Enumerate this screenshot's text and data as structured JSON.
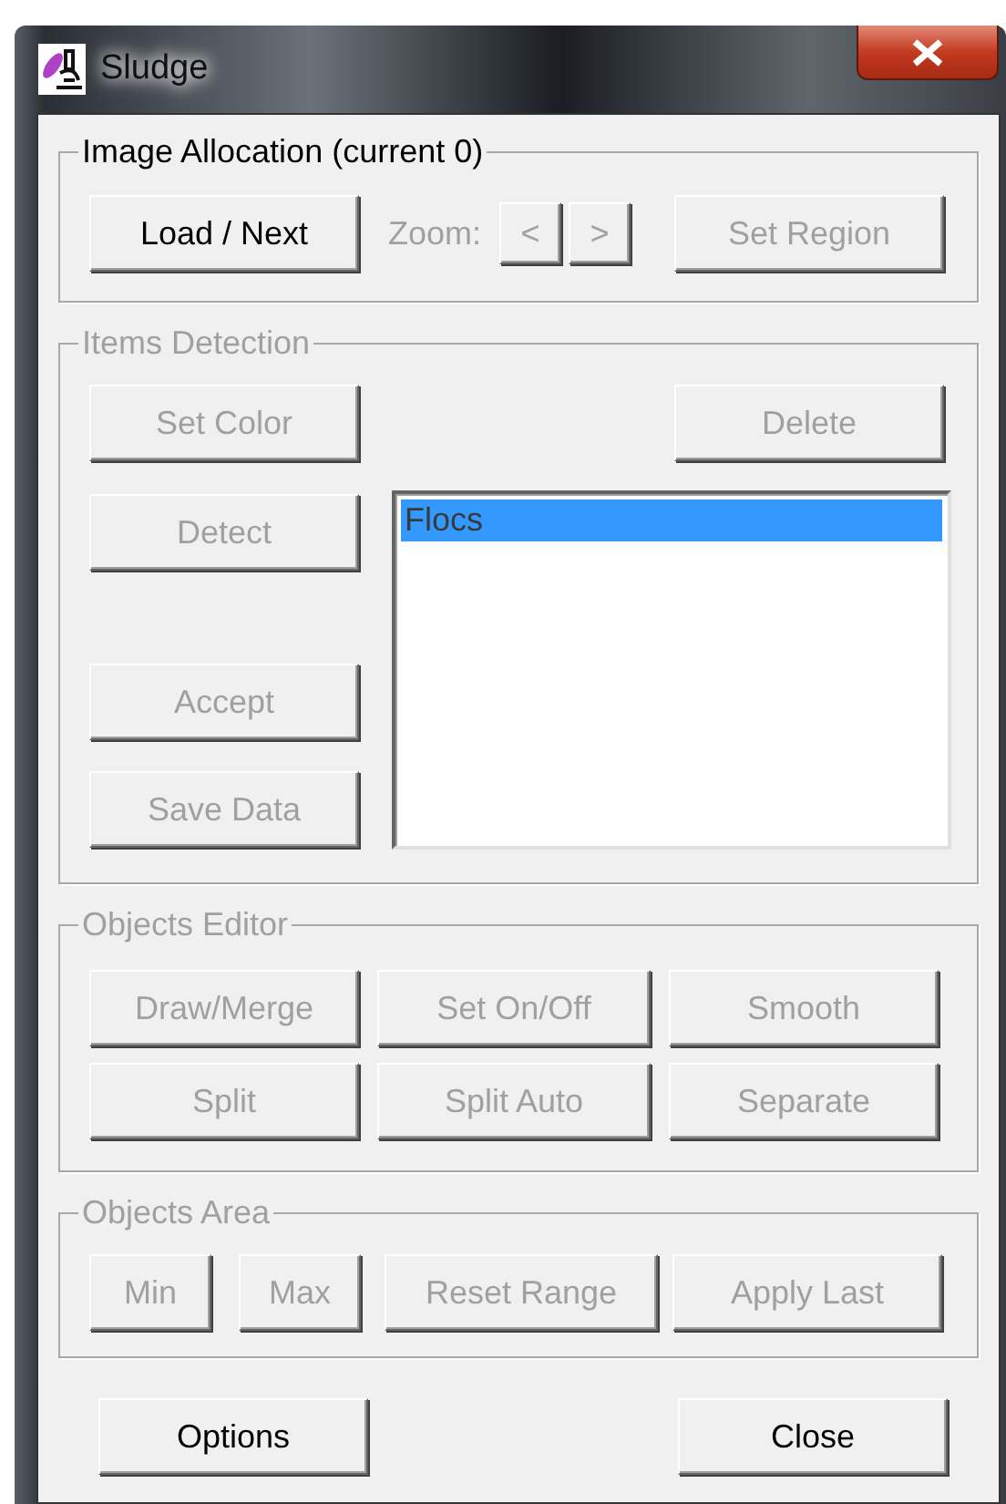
{
  "window": {
    "title": "Sludge"
  },
  "image_allocation": {
    "title": "Image Allocation (current 0)",
    "disabled": false,
    "load_button": {
      "label": "Load / Next",
      "disabled": false
    },
    "zoom_label": {
      "text": "Zoom:",
      "disabled": true
    },
    "zoom_buttons": [
      {
        "label": "<",
        "disabled": true
      },
      {
        "label": ">",
        "disabled": true
      }
    ],
    "set_region_button": {
      "label": "Set Region",
      "disabled": true
    }
  },
  "items_detection": {
    "title": "Items Detection",
    "disabled": true,
    "left_buttons": [
      {
        "label": "Set Color",
        "disabled": true
      },
      {
        "label": "Detect",
        "disabled": true
      },
      {
        "label": "Accept",
        "disabled": true
      },
      {
        "label": "Save Data",
        "disabled": true
      }
    ],
    "delete_button": {
      "label": "Delete",
      "disabled": true
    },
    "list_items": [
      {
        "text": "Flocs",
        "selected": true
      }
    ]
  },
  "objects_editor": {
    "title": "Objects Editor",
    "disabled": true,
    "buttons": [
      {
        "label": "Draw/Merge",
        "disabled": true
      },
      {
        "label": "Set On/Off",
        "disabled": true
      },
      {
        "label": "Smooth",
        "disabled": true
      },
      {
        "label": "Split",
        "disabled": true
      },
      {
        "label": "Split Auto",
        "disabled": true
      },
      {
        "label": "Separate",
        "disabled": true
      }
    ]
  },
  "objects_area": {
    "title": "Objects Area",
    "disabled": true,
    "buttons": [
      {
        "label": "Min",
        "disabled": true
      },
      {
        "label": "Max",
        "disabled": true
      },
      {
        "label": "Reset Range",
        "disabled": true
      },
      {
        "label": "Apply Last",
        "disabled": true
      }
    ]
  },
  "footer_buttons": [
    {
      "label": "Options",
      "disabled": false
    },
    {
      "label": "Close",
      "disabled": false
    }
  ]
}
